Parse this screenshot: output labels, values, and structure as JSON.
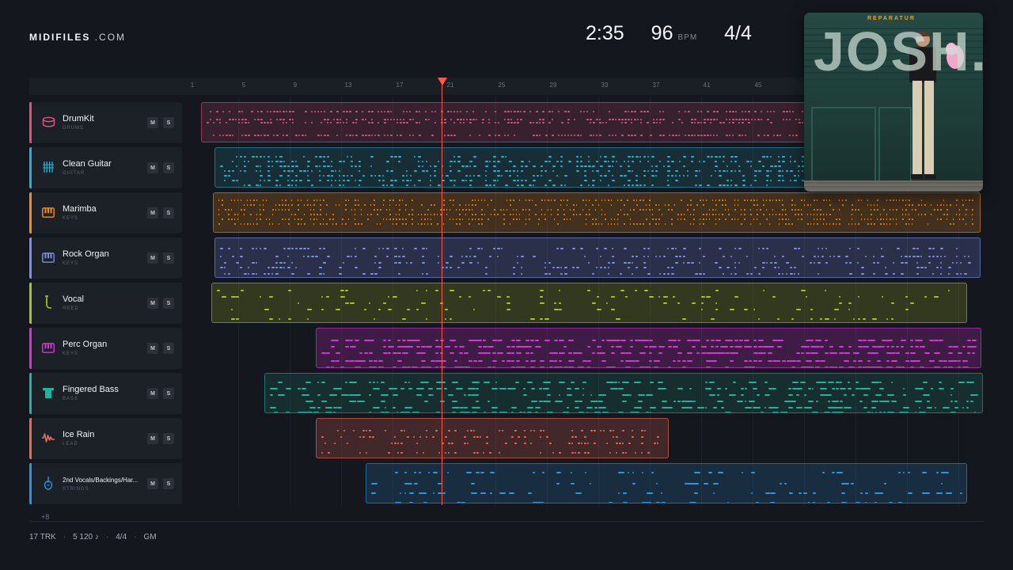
{
  "brand": {
    "name": "MIDIFILES",
    "suffix": ".COM"
  },
  "transport": {
    "time": "2:35",
    "bpm": "96",
    "bpm_unit": "BPM",
    "signature": "4/4"
  },
  "ruler": {
    "ticks": [
      "1",
      "5",
      "9",
      "13",
      "17",
      "21",
      "25",
      "29",
      "33",
      "37",
      "41",
      "45"
    ]
  },
  "colors": {
    "playhead": "#ff5a4e",
    "background": "#14171d"
  },
  "album": {
    "artist": "JOSH.",
    "title": "REPARATUR"
  },
  "tracks": [
    {
      "name": "DrumKit",
      "category": "DRUMS",
      "color": "#e0527e",
      "icon": "drum-icon",
      "mute": "M",
      "solo": "S"
    },
    {
      "name": "Clean Guitar",
      "category": "GUITAR",
      "color": "#26b3cf",
      "icon": "guitar-icon",
      "mute": "M",
      "solo": "S"
    },
    {
      "name": "Marimba",
      "category": "KEYS",
      "color": "#ef8f22",
      "icon": "keys-icon",
      "mute": "M",
      "solo": "S"
    },
    {
      "name": "Rock Organ",
      "category": "KEYS",
      "color": "#7d8fe6",
      "icon": "keys-icon",
      "mute": "M",
      "solo": "S"
    },
    {
      "name": "Vocal",
      "category": "REED",
      "color": "#a8c424",
      "icon": "reed-icon",
      "mute": "M",
      "solo": "S"
    },
    {
      "name": "Perc Organ",
      "category": "KEYS",
      "color": "#d733d6",
      "icon": "keys-icon",
      "mute": "M",
      "solo": "S"
    },
    {
      "name": "Fingered Bass",
      "category": "BASS",
      "color": "#1fb49c",
      "icon": "bass-icon",
      "mute": "M",
      "solo": "S"
    },
    {
      "name": "Ice Rain",
      "category": "LEAD",
      "color": "#ee6a55",
      "icon": "wave-icon",
      "mute": "M",
      "solo": "S"
    },
    {
      "name": "2nd Vocals/Backings/Har...",
      "category": "STRINGS",
      "color": "#2a97e0",
      "icon": "violin-icon",
      "mute": "M",
      "solo": "S"
    }
  ],
  "more_tracks": "+8",
  "footer": {
    "tracks": "17 TRK",
    "notes": "5 120 ♪",
    "signature": "4/4",
    "standard": "GM"
  }
}
